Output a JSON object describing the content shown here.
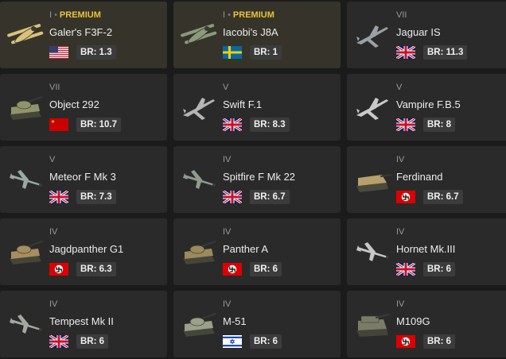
{
  "cards": [
    {
      "rank": "I",
      "premium": true,
      "premium_label": "PREMIUM",
      "name": "Galer's F3F-2",
      "nation": "usa",
      "flag_icon": "usa-flag-icon",
      "br_label": "BR: 1.3",
      "thumb": "biplane-icon",
      "thumb_color": "#d9c27a"
    },
    {
      "rank": "I",
      "premium": true,
      "premium_label": "PREMIUM",
      "name": "Iacobi's J8A",
      "nation": "sweden",
      "flag_icon": "sweden-flag-icon",
      "br_label": "BR: 1",
      "thumb": "biplane-icon",
      "thumb_color": "#8a9a7a"
    },
    {
      "rank": "VII",
      "premium": false,
      "name": "Jaguar IS",
      "nation": "uk",
      "flag_icon": "uk-flag-icon",
      "br_label": "BR: 11.3",
      "thumb": "jet-icon",
      "thumb_color": "#9aa0a6"
    },
    {
      "rank": "VII",
      "premium": false,
      "name": "Object 292",
      "nation": "ussr",
      "flag_icon": "ussr-flag-icon",
      "br_label": "BR: 10.7",
      "thumb": "tank-icon",
      "thumb_color": "#8f946b"
    },
    {
      "rank": "V",
      "premium": false,
      "name": "Swift F.1",
      "nation": "uk",
      "flag_icon": "uk-flag-icon",
      "br_label": "BR: 8.3",
      "thumb": "jet-icon",
      "thumb_color": "#b5b5b5"
    },
    {
      "rank": "V",
      "premium": false,
      "name": "Vampire F.B.5",
      "nation": "uk",
      "flag_icon": "uk-flag-icon",
      "br_label": "BR: 8",
      "thumb": "jet-icon",
      "thumb_color": "#c9c9c9"
    },
    {
      "rank": "V",
      "premium": false,
      "name": "Meteor F Mk 3",
      "nation": "uk",
      "flag_icon": "uk-flag-icon",
      "br_label": "BR: 7.3",
      "thumb": "prop-plane-icon",
      "thumb_color": "#9aa8a4"
    },
    {
      "rank": "IV",
      "premium": false,
      "name": "Spitfire F Mk 22",
      "nation": "uk",
      "flag_icon": "uk-flag-icon",
      "br_label": "BR: 6.7",
      "thumb": "prop-plane-icon",
      "thumb_color": "#8f9c8c"
    },
    {
      "rank": "IV",
      "premium": false,
      "name": "Ferdinand",
      "nation": "germany",
      "flag_icon": "germany-flag-icon",
      "br_label": "BR: 6.7",
      "thumb": "tank-destroyer-icon",
      "thumb_color": "#b8a06a"
    },
    {
      "rank": "IV",
      "premium": false,
      "name": "Jagdpanther G1",
      "nation": "germany",
      "flag_icon": "germany-flag-icon",
      "br_label": "BR: 6.3",
      "thumb": "tank-icon",
      "thumb_color": "#a88e5e"
    },
    {
      "rank": "IV",
      "premium": false,
      "name": "Panther A",
      "nation": "germany",
      "flag_icon": "germany-flag-icon",
      "br_label": "BR: 6",
      "thumb": "tank-icon",
      "thumb_color": "#9c8a5c"
    },
    {
      "rank": "IV",
      "premium": false,
      "name": "Hornet Mk.III",
      "nation": "uk",
      "flag_icon": "uk-flag-icon",
      "br_label": "BR: 6",
      "thumb": "prop-plane-icon",
      "thumb_color": "#c7c7c7"
    },
    {
      "rank": "IV",
      "premium": false,
      "name": "Tempest Mk II",
      "nation": "uk",
      "flag_icon": "uk-flag-icon",
      "br_label": "BR: 6",
      "thumb": "prop-plane-icon",
      "thumb_color": "#a3a9a0"
    },
    {
      "rank": "IV",
      "premium": false,
      "name": "M-51",
      "nation": "israel",
      "flag_icon": "israel-flag-icon",
      "br_label": "BR: 6",
      "thumb": "tank-icon",
      "thumb_color": "#9aa08a"
    },
    {
      "rank": "IV",
      "premium": false,
      "name": "M109G",
      "nation": "germany",
      "flag_icon": "germany-flag-icon",
      "br_label": "BR: 6",
      "thumb": "spg-icon",
      "thumb_color": "#7a7c68"
    }
  ],
  "colors": {
    "background": "#1b1b1b",
    "card": "#2a2a2a",
    "premium_card": "#36342a",
    "premium_text": "#e9c23c",
    "br_badge": "#3c3c3c"
  }
}
